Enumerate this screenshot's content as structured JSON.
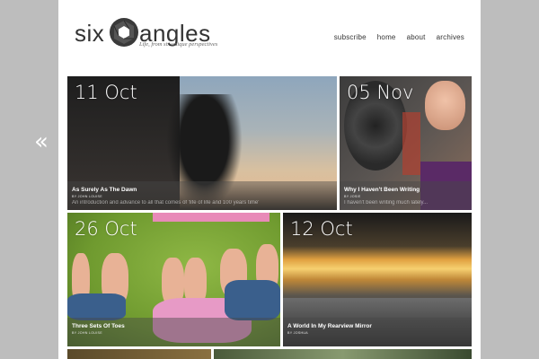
{
  "site": {
    "logo_word_1": "six",
    "logo_word_2": "angles",
    "tagline": "Life, from six unique perspectives"
  },
  "nav": [
    {
      "label": "subscribe"
    },
    {
      "label": "home"
    },
    {
      "label": "about"
    },
    {
      "label": "archives"
    }
  ],
  "prev_arrow": "«",
  "posts": [
    {
      "date": "11 Oct",
      "title": "As Surely As The Dawn",
      "author": "BY JOHN LOUISE",
      "excerpt": "An introduction and advance to all that comes of 'life of life and 100 years time'"
    },
    {
      "date": "05 Nov",
      "title": "Why I Haven't Been Writing",
      "author": "BY JOSIE",
      "excerpt": "I haven't been writing much lately..."
    },
    {
      "date": "26 Oct",
      "title": "Three Sets Of Toes",
      "author": "BY JOHN LOUISE",
      "excerpt": ""
    },
    {
      "date": "12 Oct",
      "title": "A World In My Rearview Mirror",
      "author": "BY JOSHUA",
      "excerpt": ""
    }
  ],
  "colors": {
    "page_bg": "#bdbdbd",
    "content_bg": "#ffffff",
    "text_dark": "#333333"
  }
}
